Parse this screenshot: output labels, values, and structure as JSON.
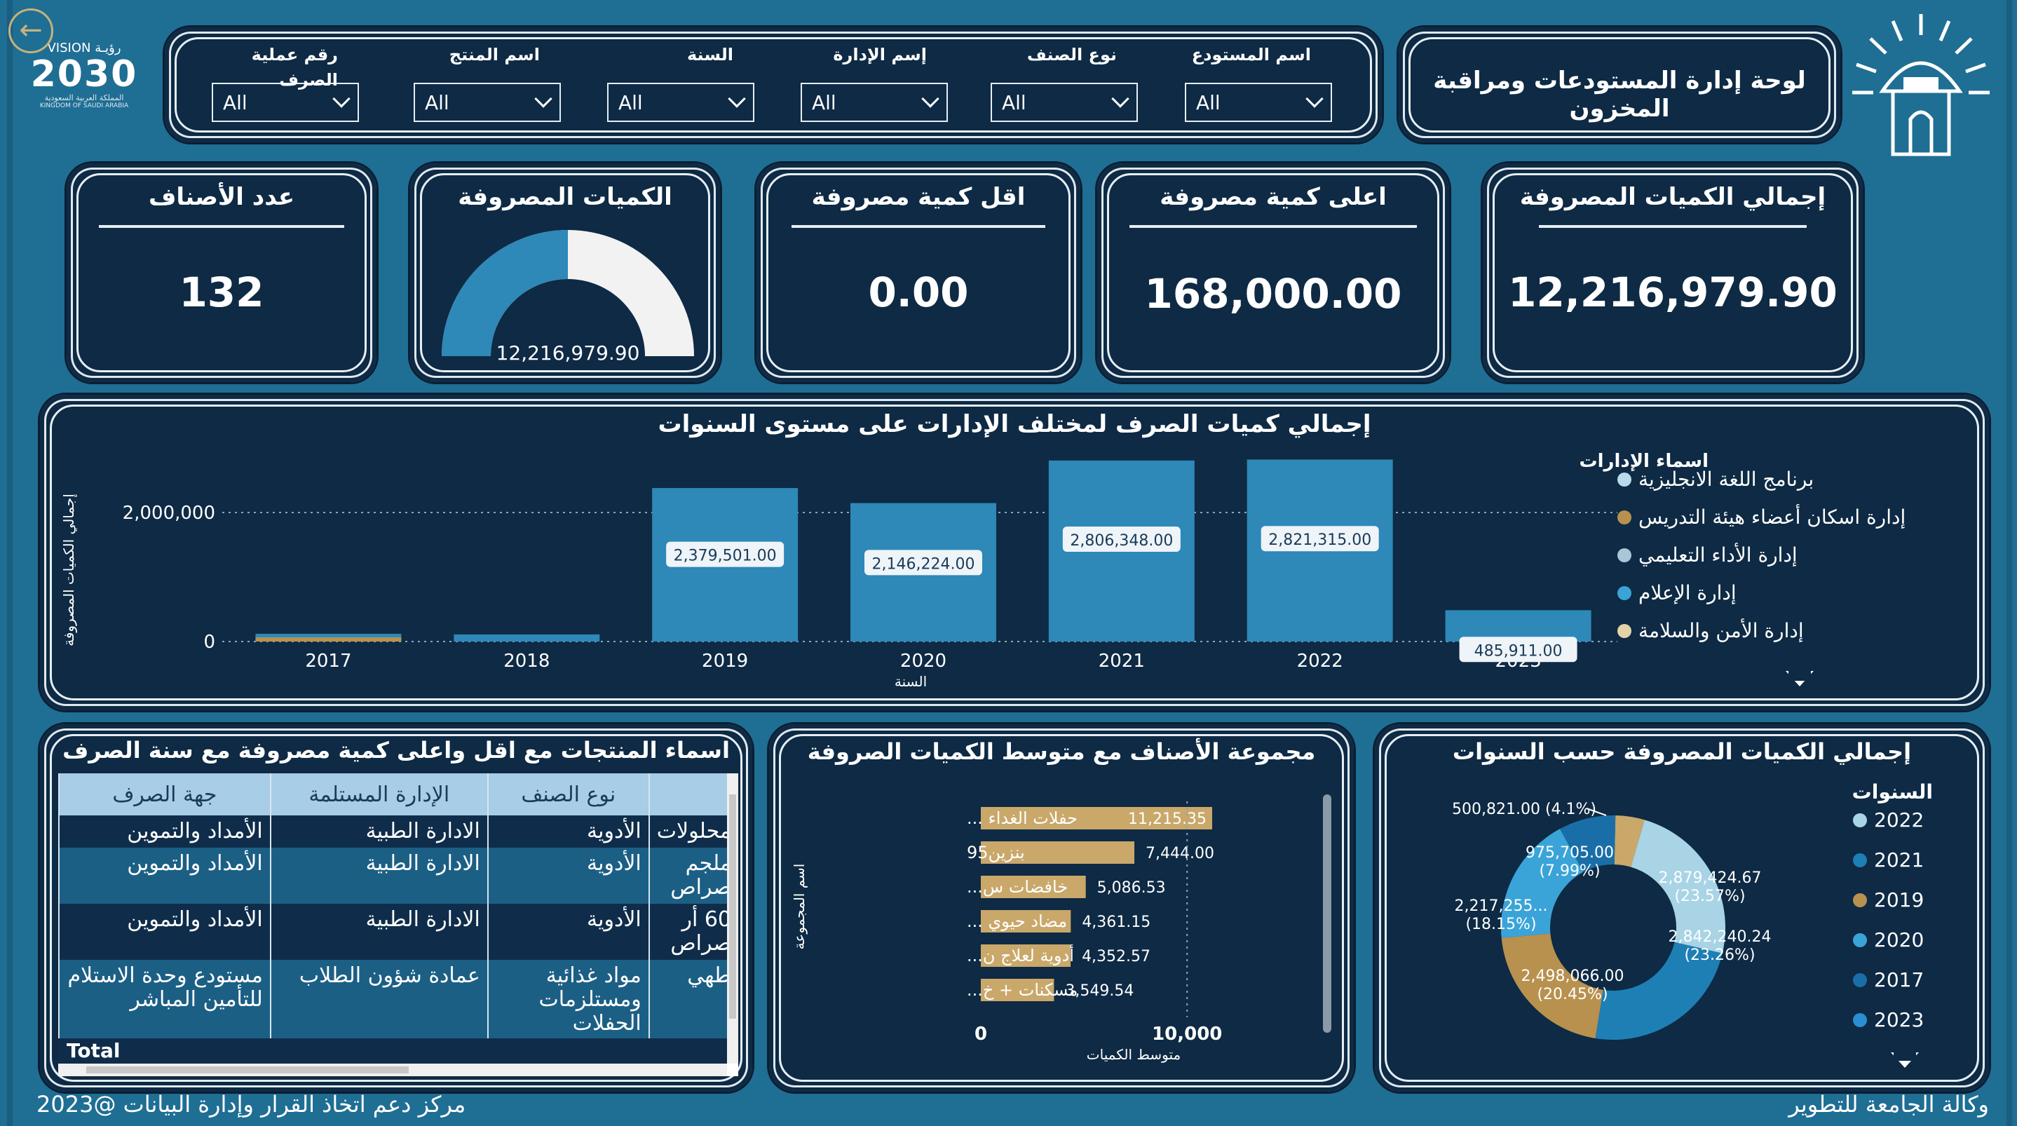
{
  "header": {
    "title": "لوحة إدارة المستودعات ومراقبة المخزون",
    "vision_logo": {
      "line1": "VISION رؤيـة",
      "year": "2030",
      "line2": "المملكة العربية السعودية",
      "line3": "KINGDOM OF SAUDI ARABIA"
    }
  },
  "filters": [
    {
      "label": "اسم المستودع",
      "value": "All"
    },
    {
      "label": "نوع الصنف",
      "value": "All"
    },
    {
      "label": "إسم الإدارة",
      "value": "All"
    },
    {
      "label": "السنة",
      "value": "All"
    },
    {
      "label": "اسم المنتج",
      "value": "All"
    },
    {
      "label": "رقم عملية الصرف",
      "value": "All"
    }
  ],
  "kpis": {
    "total": {
      "title": "إجمالي الكميات المصروفة",
      "value": "12,216,979.90"
    },
    "max": {
      "title": "اعلى كمية مصروفة",
      "value": "168,000.00"
    },
    "min": {
      "title": "اقل كمية مصروفة",
      "value": "0.00"
    },
    "gauge": {
      "title": "الكميات المصروفة",
      "value": "12,216,979.90",
      "fill": 0.5
    },
    "count": {
      "title": "عدد الأصناف",
      "value": "132"
    }
  },
  "bar_chart": {
    "title": "إجمالي كميات الصرف لمختلف الإدارات على مستوى السنوات",
    "ylabel": "إجمالي الكميات المصروفة",
    "xlabel": "السنة",
    "legend_title": "اسماء الإدارات",
    "legend": [
      {
        "name": "برنامج اللغة الانجليزية",
        "color": "#b7dbe9"
      },
      {
        "name": "إدارة اسكان أعضاء هيئة التدريس",
        "color": "#b8914f"
      },
      {
        "name": "إدارة الأداء التعليمي",
        "color": "#a9c6d6"
      },
      {
        "name": "إدارة الإعلام",
        "color": "#3aa4d8"
      },
      {
        "name": "إدارة الأمن والسلامة",
        "color": "#e4d3a8"
      }
    ]
  },
  "mid_chart": {
    "title": "مجموعة الأصناف مع متوسط الكميات الصروفة",
    "ylabel": "اسم المجموعة",
    "xlabel": "متوسط الكميات"
  },
  "donut_chart": {
    "title": "إجمالي الكميات المصروفة حسب السنوات",
    "legend_title": "السنوات",
    "legend": [
      {
        "name": "2022",
        "color": "#a8d4e6"
      },
      {
        "name": "2021",
        "color": "#1e7fb5"
      },
      {
        "name": "2019",
        "color": "#b8914f"
      },
      {
        "name": "2020",
        "color": "#3aa4d8"
      },
      {
        "name": "2017",
        "color": "#1a6ea8"
      },
      {
        "name": "2023",
        "color": "#2a8fd0"
      }
    ],
    "labels": [
      {
        "text": "500,821.00 (4.1%)"
      },
      {
        "text": "975,705.00",
        "pct": "(7.99%)"
      },
      {
        "text": "2,879,424.67",
        "pct": "(23.57%)"
      },
      {
        "text": "2,217,255...",
        "pct": "(18.15%)"
      },
      {
        "text": "2,842,240.24",
        "pct": "(23.26%)"
      },
      {
        "text": "2,498,066.00",
        "pct": "(20.45%)"
      }
    ]
  },
  "table": {
    "title": "اسماء المنتجات مع اقل واعلى كمية مصروفة مع سنة الصرف",
    "headers": [
      "",
      "نوع الصنف",
      "الإدارة المستلمة",
      "جهة الصرف"
    ],
    "rows": [
      [
        "محلولات",
        "الأدوية",
        "الادارة الطبية",
        "الأمداد والتموين"
      ],
      [
        "ملجم صراص",
        "الأدوية",
        "الادارة الطبية",
        "الأمداد والتموين"
      ],
      [
        "60 أر صراص",
        "الأدوية",
        "الادارة الطبية",
        "الأمداد والتموين"
      ],
      [
        "طهي",
        "مواد غذائية ومستلزمات الحفلات",
        "عمادة شؤون الطلاب",
        "مستودع وحدة الاستلام للتأمين المباشر"
      ]
    ],
    "total_label": "Total"
  },
  "footer": {
    "left": "مركز دعم اتخاذ القرار وإدارة البيانات @2023",
    "right": "وكالة الجامعة للتطوير"
  },
  "chart_data": [
    {
      "type": "bar",
      "title": "إجمالي كميات الصرف لمختلف الإدارات على مستوى السنوات",
      "xlabel": "السنة",
      "ylabel": "إجمالي الكميات المصروفة",
      "categories": [
        "2017",
        "2018",
        "2019",
        "2020",
        "2021",
        "2022",
        "2023"
      ],
      "values": [
        120000,
        110000,
        2379501,
        2146224,
        2806348,
        2821315,
        485911
      ],
      "data_labels": [
        "",
        "",
        "2,379,501.00",
        "2,146,224.00",
        "2,806,348.00",
        "2,821,315.00",
        "485,911.00"
      ],
      "y_ticks": [
        "0",
        "2,000,000"
      ],
      "ylim": [
        0,
        3000000
      ],
      "grid": true,
      "legend_position": "right"
    },
    {
      "type": "bar",
      "orientation": "horizontal",
      "title": "مجموعة الأصناف مع متوسط الكميات الصروفة",
      "xlabel": "متوسط الكميات",
      "ylabel": "اسم المجموعة",
      "categories": [
        "حفلات الغداء ...",
        "بنزين95",
        "خافضات س...",
        "مضاد حيوي ...",
        "أدوية لعلاج ن...",
        "مسكنات + خ..."
      ],
      "values": [
        11215.35,
        7444.0,
        5086.53,
        4361.15,
        4352.57,
        3549.54
      ],
      "data_labels": [
        "11,215.35",
        "7,444.00",
        "5,086.53",
        "4,361.15",
        "4,352.57",
        "3,549.54"
      ],
      "x_ticks": [
        "0",
        "10,000"
      ],
      "xlim": [
        0,
        12000
      ]
    },
    {
      "type": "pie",
      "title": "إجمالي الكميات المصروفة حسب السنوات",
      "categories": [
        "2022",
        "2021",
        "2019",
        "2020",
        "2017",
        "2023"
      ],
      "values": [
        2879424.67,
        2842240.24,
        2498066.0,
        2217255,
        975705.0,
        500821.0
      ]
    }
  ]
}
